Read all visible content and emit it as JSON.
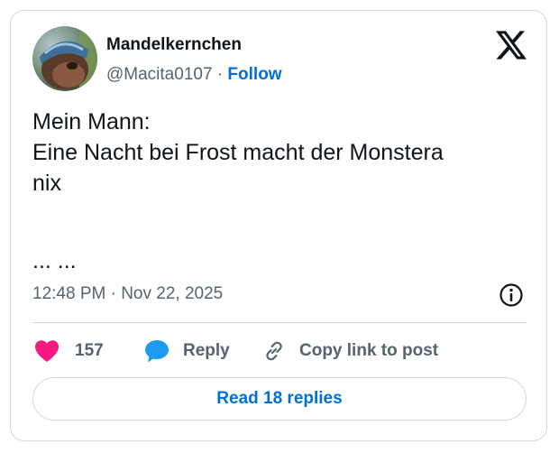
{
  "author": {
    "display_name": "Mandelkernchen",
    "handle": "@Macita0107",
    "separator": "·",
    "follow_label": "Follow"
  },
  "tweet": {
    "lines": [
      "Mein Mann:",
      "Eine Nacht bei Frost macht der Monstera",
      "nix"
    ],
    "ellipsis": "... ...",
    "timestamp": "12:48 PM · Nov 22, 2025"
  },
  "actions": {
    "like_count": "157",
    "reply_label": "Reply",
    "copy_link_label": "Copy link to post"
  },
  "read_replies_label": "Read 18 replies",
  "icons": {
    "brand": "x-logo-icon",
    "like": "heart-icon",
    "reply": "speech-bubble-icon",
    "copy": "link-icon",
    "info": "info-icon"
  },
  "colors": {
    "accent": "#006fd6",
    "heart": "#f91880",
    "reply_bubble": "#1d9bf0",
    "muted": "#536471",
    "border": "#cfd9de"
  }
}
